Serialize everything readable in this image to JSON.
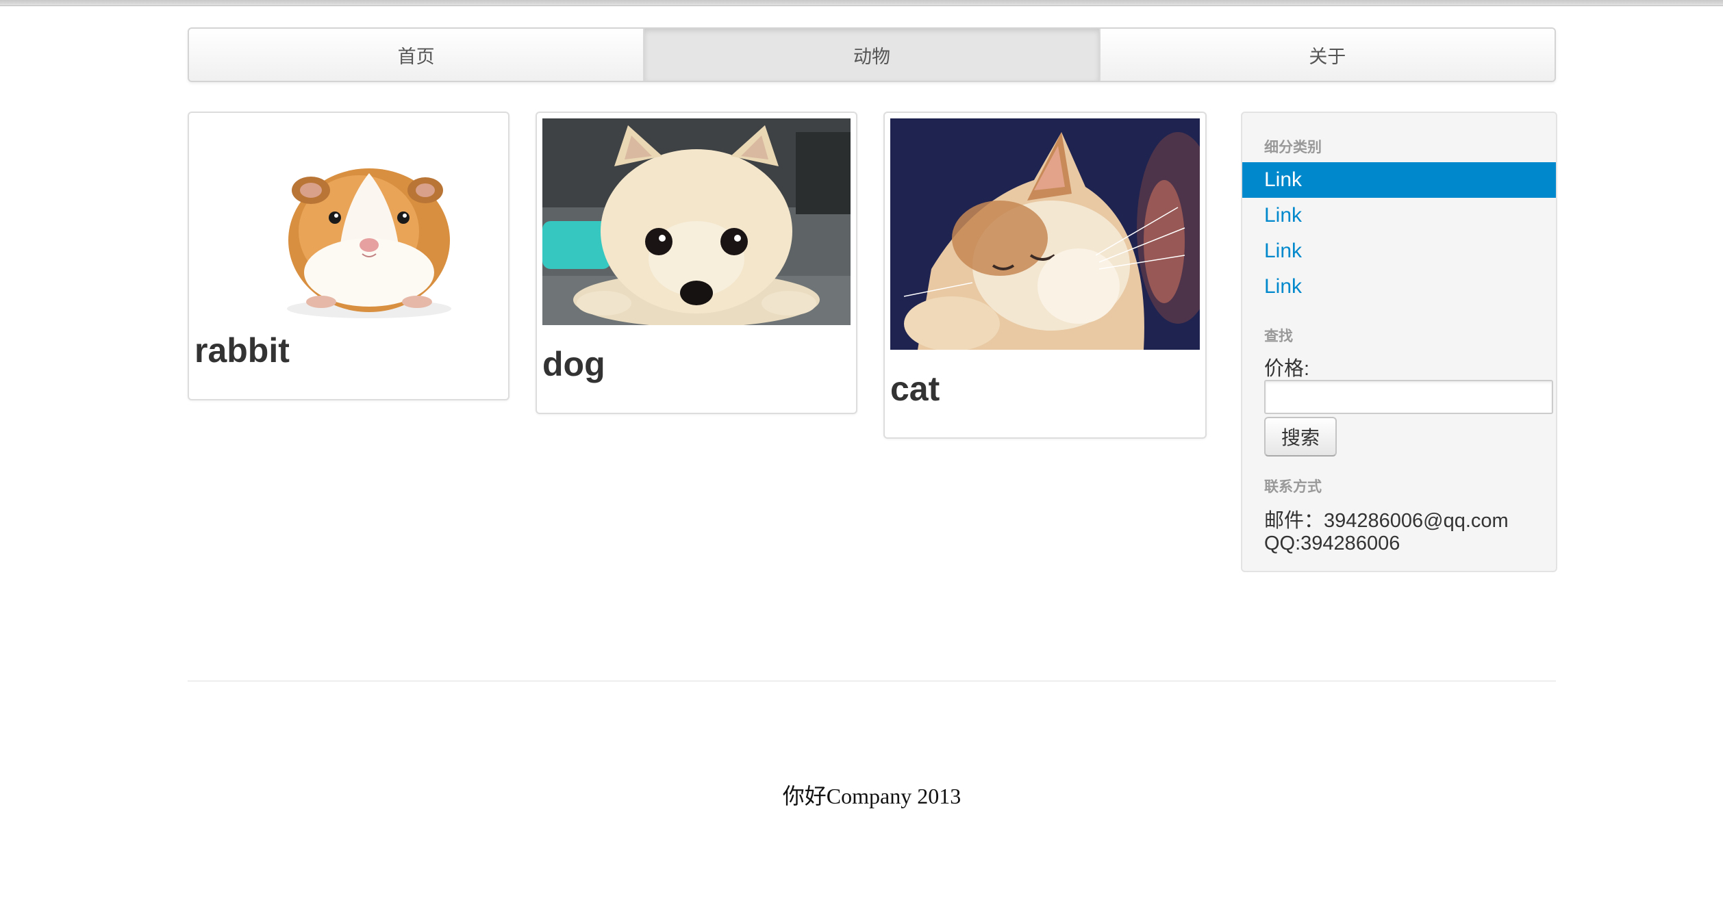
{
  "nav": {
    "items": [
      {
        "label": "首页"
      },
      {
        "label": "动物"
      },
      {
        "label": "关于"
      }
    ],
    "active_index": 1
  },
  "thumbnails": [
    {
      "caption": "rabbit",
      "image": "guinea-pig-photo"
    },
    {
      "caption": "dog",
      "image": "pomeranian-puppy-photo"
    },
    {
      "caption": "cat",
      "image": "sleeping-cat-photo"
    }
  ],
  "sidebar": {
    "category_header": "细分类别",
    "links": [
      {
        "label": "Link",
        "active": true
      },
      {
        "label": "Link",
        "active": false
      },
      {
        "label": "Link",
        "active": false
      },
      {
        "label": "Link",
        "active": false
      }
    ],
    "search_header": "查找",
    "price_label": "价格:",
    "price_value": "",
    "search_button": "搜索",
    "contact_header": "联系方式",
    "email_line": "邮件：394286006@qq.com",
    "qq_line": "QQ:394286006"
  },
  "footer": {
    "text": "你好Company 2013"
  },
  "colors": {
    "link": "#0088cc",
    "active_link_bg": "#0088cc",
    "sidebar_bg": "#f5f5f5",
    "nav_active_bg": "#e5e5e5"
  }
}
